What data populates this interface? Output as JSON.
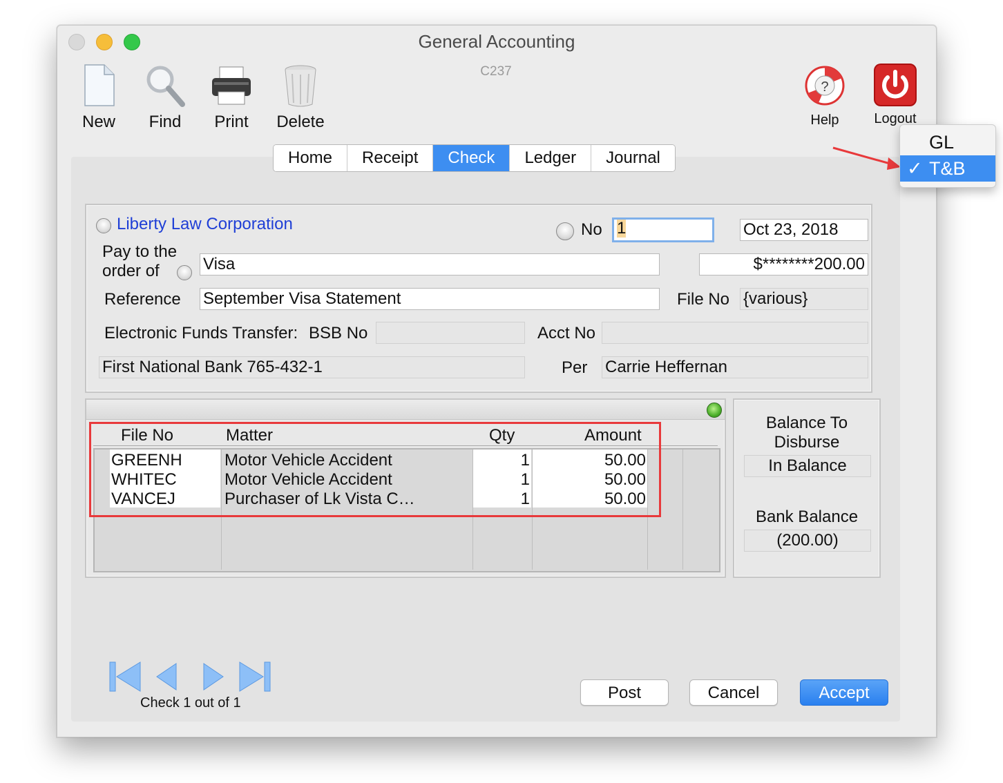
{
  "window": {
    "title": "General Accounting",
    "code": "C237"
  },
  "toolbar": {
    "new": "New",
    "find": "Find",
    "print": "Print",
    "delete": "Delete",
    "help": "Help",
    "logout": "Logout"
  },
  "menu": {
    "items": [
      "GL",
      "T&B"
    ],
    "checkmark": "✓",
    "selected": "T&B"
  },
  "tabs": [
    {
      "label": "Home"
    },
    {
      "label": "Receipt"
    },
    {
      "label": "Check",
      "active": true
    },
    {
      "label": "Ledger"
    },
    {
      "label": "Journal"
    }
  ],
  "check": {
    "payer": "Liberty Law Corporation",
    "no_label": "No",
    "no_value": "1",
    "date": "Oct 23, 2018",
    "pay_to_label_1": "Pay to the",
    "pay_to_label_2": "order of",
    "pay_to_value": "Visa",
    "amount": "$********200.00",
    "reference_label": "Reference",
    "reference_value": "September Visa Statement",
    "file_no_label": "File No",
    "file_no_value": "{various}",
    "eft_label": "Electronic Funds Transfer:",
    "bsb_label": "BSB No",
    "bsb_value": "",
    "acct_label": "Acct No",
    "acct_value": "",
    "bank": "First National Bank 765-432-1",
    "per_label": "Per",
    "per_value": "Carrie Heffernan"
  },
  "table": {
    "columns": [
      "File No",
      "Matter",
      "Qty",
      "Amount"
    ],
    "rows": [
      {
        "file_no": "GREENH",
        "matter": "Motor Vehicle Accident",
        "qty": "1",
        "amount": "50.00"
      },
      {
        "file_no": "WHITEC",
        "matter": "Motor Vehicle Accident",
        "qty": "1",
        "amount": "50.00"
      },
      {
        "file_no": "VANCEJ",
        "matter": "Purchaser of Lk Vista C…",
        "qty": "1",
        "amount": "50.00"
      }
    ]
  },
  "balance": {
    "to_disburse_label_1": "Balance To",
    "to_disburse_label_2": "Disburse",
    "to_disburse_value": "In Balance",
    "bank_label": "Bank Balance",
    "bank_value": "(200.00)"
  },
  "navigation": {
    "status": "Check 1 out of 1"
  },
  "buttons": {
    "post": "Post",
    "cancel": "Cancel",
    "accept": "Accept"
  },
  "colors": {
    "accent": "#3d8ef1",
    "highlight_box": "#e8393b",
    "link": "#1f3fd6"
  }
}
